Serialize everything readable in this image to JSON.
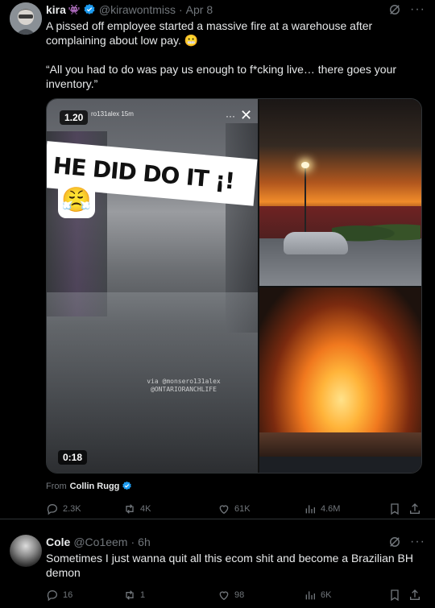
{
  "tweet1": {
    "name": "kira",
    "badge_emoji": "👾",
    "handle": "@kirawontmiss",
    "separator": "·",
    "time": "Apr 8",
    "text_line1": "A pissed off employee started a massive fire at a warehouse after complaining about low pay. 😬",
    "text_line2": "“All you had to do was pay us enough to f*cking live… there goes your inventory.”",
    "media": {
      "video_tag": "1.20",
      "overlay_handle": "ro131alex  15m",
      "banner_text": "HE DID DO IT ¡!",
      "emoji": "😤",
      "watermark_line1": "via @monsero131alex",
      "watermark_line2": "@ONTARIORANCHLIFE",
      "duration": "0:18"
    },
    "from_label": "From",
    "from_name": "Collin Rugg",
    "actions": {
      "replies": "2.3K",
      "reposts": "4K",
      "likes": "61K",
      "views": "4.6M"
    }
  },
  "tweet2": {
    "name": "Cole",
    "handle": "@Co1eem",
    "separator": "·",
    "time": "6h",
    "text": "Sometimes I just wanna quit all this ecom shit and become a Brazilian BH demon",
    "actions": {
      "replies": "16",
      "reposts": "1",
      "likes": "98",
      "views": "6K"
    }
  },
  "colors": {
    "background": "#000000",
    "text": "#e7e9ea",
    "muted": "#71767b",
    "verified": "#1d9bf0",
    "border": "#2f3336"
  }
}
